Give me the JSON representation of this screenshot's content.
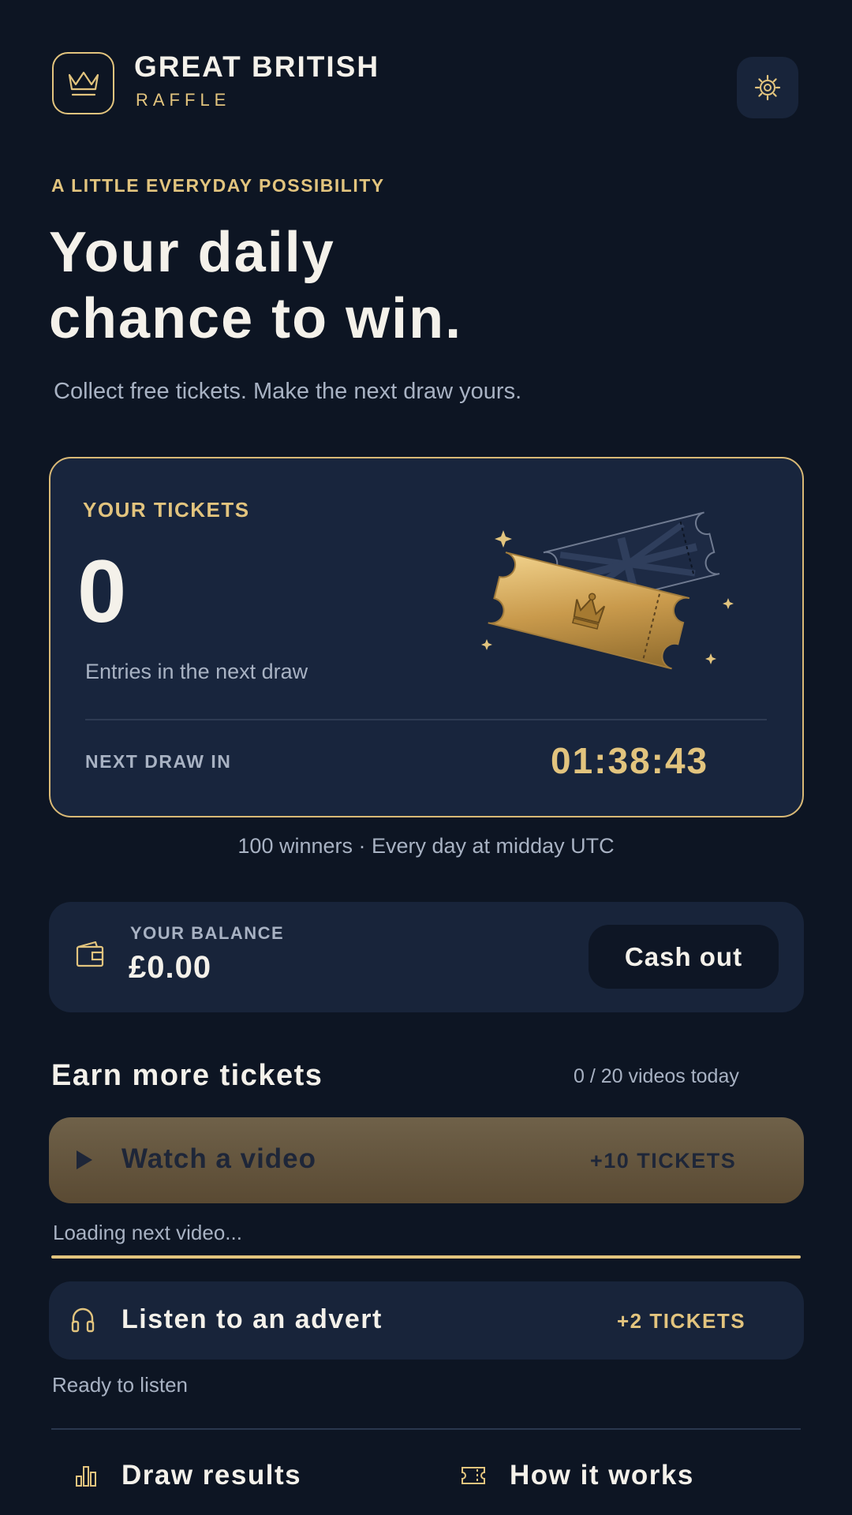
{
  "header": {
    "brand_title": "GREAT BRITISH",
    "brand_subtitle": "RAFFLE",
    "logo_icon": "crown-icon",
    "settings_icon": "gear-icon"
  },
  "hero": {
    "eyebrow": "A LITTLE EVERYDAY POSSIBILITY",
    "title_line1": "Your daily",
    "title_line2": "chance to win.",
    "subtitle": "Collect free tickets. Make the next draw yours."
  },
  "tickets_card": {
    "label": "YOUR TICKETS",
    "count": "0",
    "caption": "Entries in the next draw",
    "next_draw_label": "NEXT DRAW IN",
    "countdown": "01:38:43"
  },
  "winners_note": "100 winners · Every day at midday UTC",
  "balance": {
    "label": "YOUR BALANCE",
    "value": "£0.00",
    "cashout_label": "Cash out",
    "icon": "wallet-icon"
  },
  "earn": {
    "title": "Earn more tickets",
    "progress_text": "0 / 20 videos today",
    "watch": {
      "label": "Watch a video",
      "reward": "+10 TICKETS",
      "icon": "play-icon",
      "status": "Loading next video..."
    },
    "listen": {
      "label": "Listen to an advert",
      "reward": "+2 TICKETS",
      "icon": "headphones-icon",
      "status": "Ready to listen"
    }
  },
  "footer": {
    "draw_results_label": "Draw results",
    "how_it_works_label": "How it works"
  },
  "colors": {
    "background": "#0d1523",
    "card": "#18243a",
    "gold": "#e2c47e",
    "muted_text": "#a8b2c3",
    "primary_text": "#f4f1ea"
  }
}
